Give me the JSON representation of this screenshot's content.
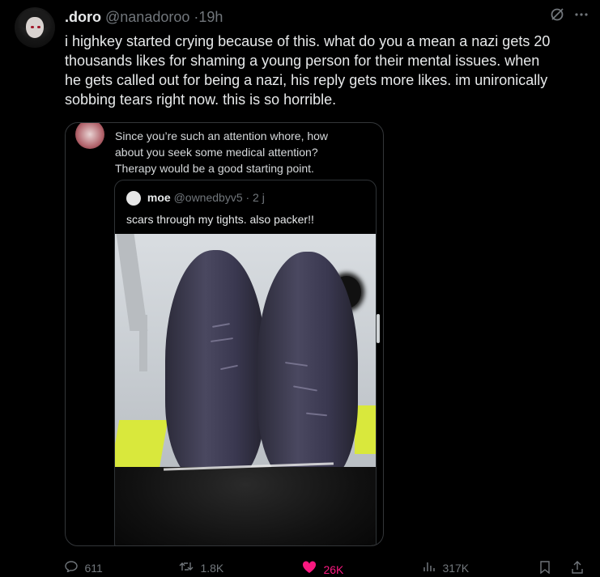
{
  "tweet": {
    "author_name": ".doro",
    "author_handle": "@nanadoroo",
    "separator": "·",
    "time": "19h",
    "text_lines": [
      "i highkey started crying because of this. what do you a mean a nazi gets 20",
      "thousands likes for shaming a young person for their mental issues. when",
      "he gets called out for being a nazi, his reply gets more likes. im unironically",
      "sobbing tears right now.  this is so horrible."
    ]
  },
  "embedded": {
    "quote_lines": [
      "Since you’re such an attention whore, how",
      "about you seek some medical attention?",
      "Therapy would be a good starting point."
    ],
    "inner_name": "moe",
    "inner_handle": "@ownedbyv5 · 2 j",
    "inner_text": "scars through my tights. also packer!!"
  },
  "actions": {
    "replies": "611",
    "reposts": "1.8K",
    "likes": "26K",
    "views": "317K"
  },
  "icons": {
    "more": "more-icon",
    "grok": "grok-icon",
    "reply": "reply-icon",
    "repost": "repost-icon",
    "like": "heart-icon",
    "views": "views-icon",
    "bookmark": "bookmark-icon",
    "share": "share-icon"
  },
  "colors": {
    "background": "#000000",
    "text": "#e7e9ea",
    "secondary": "#71767b",
    "like": "#f91880"
  }
}
